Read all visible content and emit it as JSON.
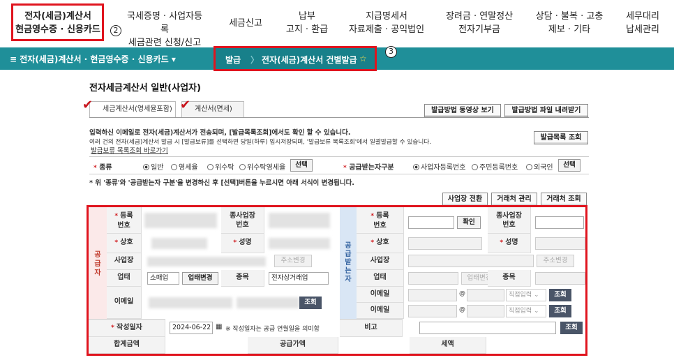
{
  "nav": {
    "item1_line1": "전자(세금)계산서",
    "item1_line2": "현금영수증 · 신용카드",
    "item2_line1": "국세증명 · 사업자등록",
    "item2_line2": "세금관련 신청/신고",
    "item3": "세금신고",
    "item4_line1": "납부",
    "item4_line2": "고지 · 환급",
    "item5_line1": "지급명세서",
    "item5_line2": "자료제출 · 공익법인",
    "item6_line1": "장려금 · 연말정산",
    "item6_line2": "전자기부금",
    "item7_line1": "상담 · 불복 · 고충",
    "item7_line2": "제보 · 기타",
    "item8_line1": "세무대리",
    "item8_line2": "납세관리",
    "marker2": "2",
    "marker3": "3"
  },
  "menubar": {
    "menu_label": "≡  전자(세금)계산서 · 현금영수증 · 신용카드  ▾",
    "crumb1": "발급",
    "crumb2": "전자(세금)계산서 건별발급",
    "star": "☆"
  },
  "page": {
    "title": "전자세금계산서 일반(사업자)",
    "tab1": "세금계산서(영세율포함)",
    "tab2": "계산서(면세)",
    "btn_video": "발급방법 동영상 보기",
    "btn_file": "발급방법 파일 내려받기",
    "notice_red": "입력하신 이메일로 전자(세금)계산서가 전송되며, [발급목록조회]에서도 확인 할 수 있습니다.",
    "notice_body": "여러 건의 전자(세금)계산서 발급 시 [발급보류]를 선택하면 당일(하루) 임시저장되며, '발급보류 목록조회'에서 일괄발급할 수 있습니다.",
    "notice_link": "발급보류 목록조회 바로가기",
    "btn_list": "발급목록 조회",
    "kind_label": "종류",
    "kind_opts": [
      "일반",
      "영세율",
      "위수탁",
      "위수탁영세율"
    ],
    "select_btn": "선택",
    "recv_label": "공급받는자구분",
    "recv_opts": [
      "사업자등록번호",
      "주민등록번호",
      "외국인"
    ],
    "warn": "* 위 '종류'와 '공급받는자 구분'을 변경하신 후 [선택]버튼을 누르시면 아래 서식이 변경됩니다.",
    "btn_switch": "사업장 전환",
    "btn_manage": "거래처 관리",
    "btn_lookup": "거래처 조회"
  },
  "supplier": {
    "side": "공급자",
    "reg_no": "등록\n번호",
    "sub_no": "종사업장\n번호",
    "name": "상호",
    "ceo": "성명",
    "address": "사업장",
    "addr_btn": "주소변경",
    "biz_type": "업태",
    "biz_type_val": "소매업",
    "biz_change": "업태변경",
    "item": "종목",
    "item_val": "전자상거래업",
    "email": "이메일",
    "lookup": "조회"
  },
  "receiver": {
    "side": "공급받는자",
    "reg_no": "등록\n번호",
    "confirm": "확인",
    "sub_no": "종사업장\n번호",
    "name": "상호",
    "ceo": "성명",
    "address": "사업장",
    "addr_btn": "주소변경",
    "biz_type": "업태",
    "biz_change": "업태변경",
    "item": "종목",
    "email": "이메일",
    "at": "@",
    "direct": "직접입력",
    "lookup": "조회"
  },
  "bottom": {
    "date_label": "작성일자",
    "date_val": "2024-06-22",
    "date_note": "※ 작성일자는 공급 연월일을 의미함",
    "memo": "비고",
    "lookup": "조회",
    "total": "합계금액",
    "supply": "공급가액",
    "tax": "세액"
  }
}
